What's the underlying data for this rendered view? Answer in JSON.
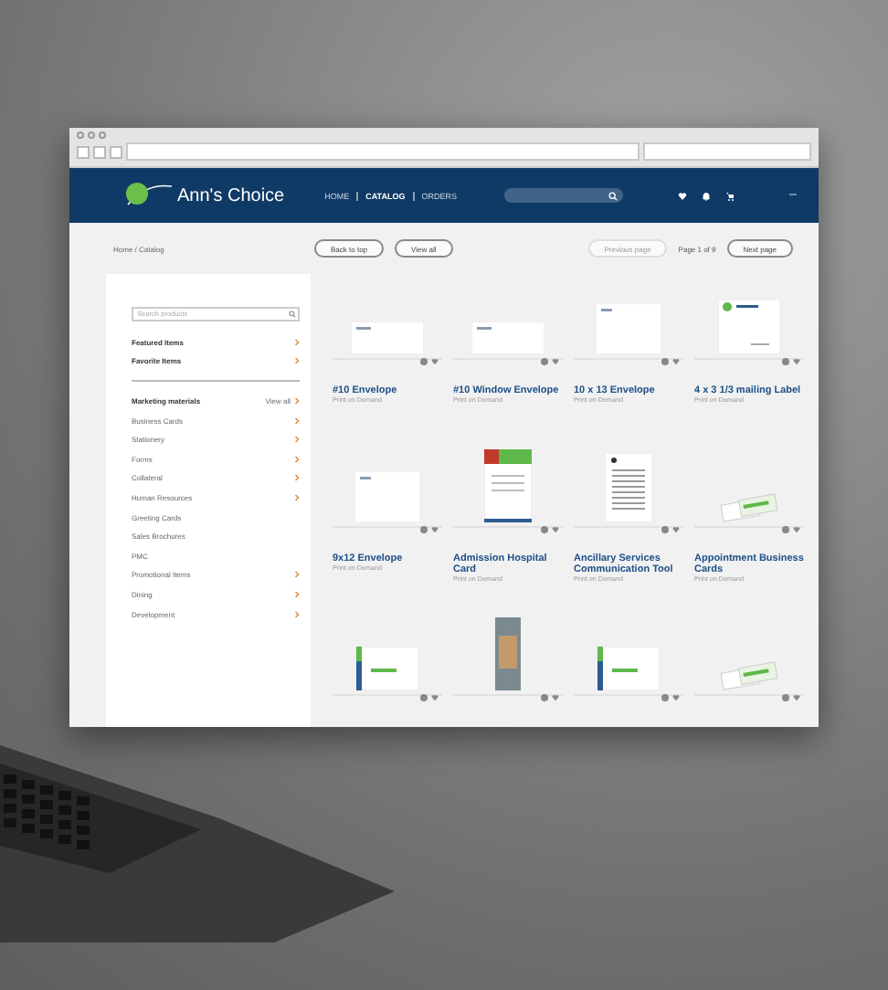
{
  "logo": {
    "name": "Ann's Choice"
  },
  "nav": [
    {
      "label": "HOME",
      "selected": false
    },
    {
      "label": "CATALOG",
      "selected": true
    },
    {
      "label": "ORDERS",
      "selected": false
    }
  ],
  "toolbar": {
    "breadcrumb": "Home / Catalog",
    "buttons": [
      {
        "label": "Back to top",
        "disabled": false
      },
      {
        "label": "View all",
        "disabled": false
      }
    ],
    "prev": {
      "label": "Previous page",
      "disabled": true
    },
    "page": "Page 1 of 9",
    "next": {
      "label": "Next page",
      "disabled": false
    }
  },
  "sidebar": {
    "search": {
      "placeholder": "Search products"
    },
    "featured": [
      {
        "label": "Featured Items",
        "expandable": true
      },
      {
        "label": "Favorite Items",
        "expandable": true
      }
    ],
    "section": {
      "title": "Marketing materials",
      "link": "View all"
    },
    "items": [
      {
        "label": "Business Cards",
        "expandable": true
      },
      {
        "label": "Stationery",
        "expandable": true
      },
      {
        "label": "Forms",
        "expandable": true
      },
      {
        "label": "Collateral",
        "expandable": true
      },
      {
        "label": "Human Resources",
        "expandable": true
      },
      {
        "label": "Greeting Cards",
        "expandable": false
      },
      {
        "label": "Sales Brochures",
        "expandable": false
      },
      {
        "label": "PMC",
        "expandable": false
      },
      {
        "label": "Promotional Items",
        "expandable": true
      },
      {
        "label": "Dining",
        "expandable": true
      },
      {
        "label": "Development",
        "expandable": true
      }
    ]
  },
  "products": [
    {
      "kind": "envelope",
      "name": "#10 Envelope",
      "note": "Print on Demand"
    },
    {
      "kind": "envelope",
      "name": "#10 Window Envelope",
      "note": "Print on Demand"
    },
    {
      "kind": "sheet",
      "name": "10 x 13 Envelope",
      "note": "Print on Demand"
    },
    {
      "kind": "label",
      "name": "4 x 3 1/3 mailing Label",
      "note": "Print on Demand"
    },
    {
      "kind": "sheet",
      "name": "9x12 Envelope",
      "note": "Print on Demand"
    },
    {
      "kind": "flyer",
      "name": "Admission Hospital Card",
      "note": "Print on Demand"
    },
    {
      "kind": "letter",
      "name": "Ancillary Services Communication Tool",
      "note": "Print on Demand"
    },
    {
      "kind": "cards",
      "name": "Appointment Business Cards",
      "note": "Print on Demand"
    },
    {
      "kind": "card"
    },
    {
      "kind": "banner"
    },
    {
      "kind": "card"
    },
    {
      "kind": "cards"
    }
  ]
}
